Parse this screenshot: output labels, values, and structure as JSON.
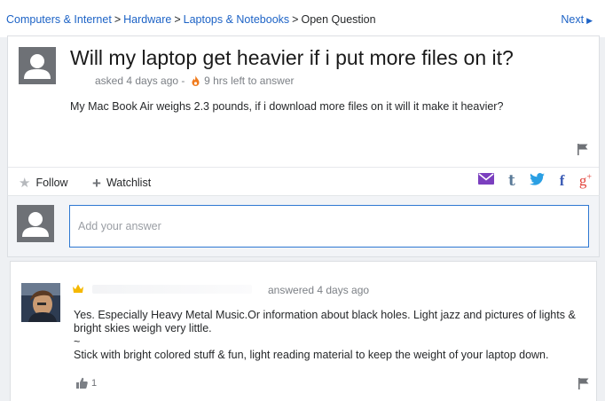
{
  "breadcrumb": {
    "items": [
      "Computers & Internet",
      "Hardware",
      "Laptops & Notebooks"
    ],
    "current": "Open Question",
    "separator": ">"
  },
  "nav": {
    "next_label": "Next"
  },
  "question": {
    "title": "Will my laptop get heavier if i put more files on it?",
    "asked": "asked 4 days ago",
    "meta_separator": "-",
    "time_left": "9 hrs left to answer",
    "body": "My Mac Book Air weighs 2.3 pounds, if i download more files on it will it make it heavier?"
  },
  "actions": {
    "follow_label": "Follow",
    "watchlist_label": "Watchlist",
    "share_icons": [
      "mail-icon",
      "tumblr-icon",
      "twitter-icon",
      "facebook-icon",
      "google-plus-icon"
    ]
  },
  "answer_box": {
    "placeholder": "Add your answer"
  },
  "answers": [
    {
      "meta": "answered 4 days ago",
      "lines": [
        "Yes. Especially Heavy Metal Music.Or information about black holes. Light jazz and pictures of lights & bright skies weigh very little.",
        "~",
        "Stick with bright colored stuff & fun, light reading material to keep the weight of your laptop down."
      ],
      "likes": "1"
    }
  ],
  "colors": {
    "link": "#1d63c6",
    "flame": "#f07b1d",
    "input_border": "#2e78d2",
    "crown": "#f5b800"
  }
}
